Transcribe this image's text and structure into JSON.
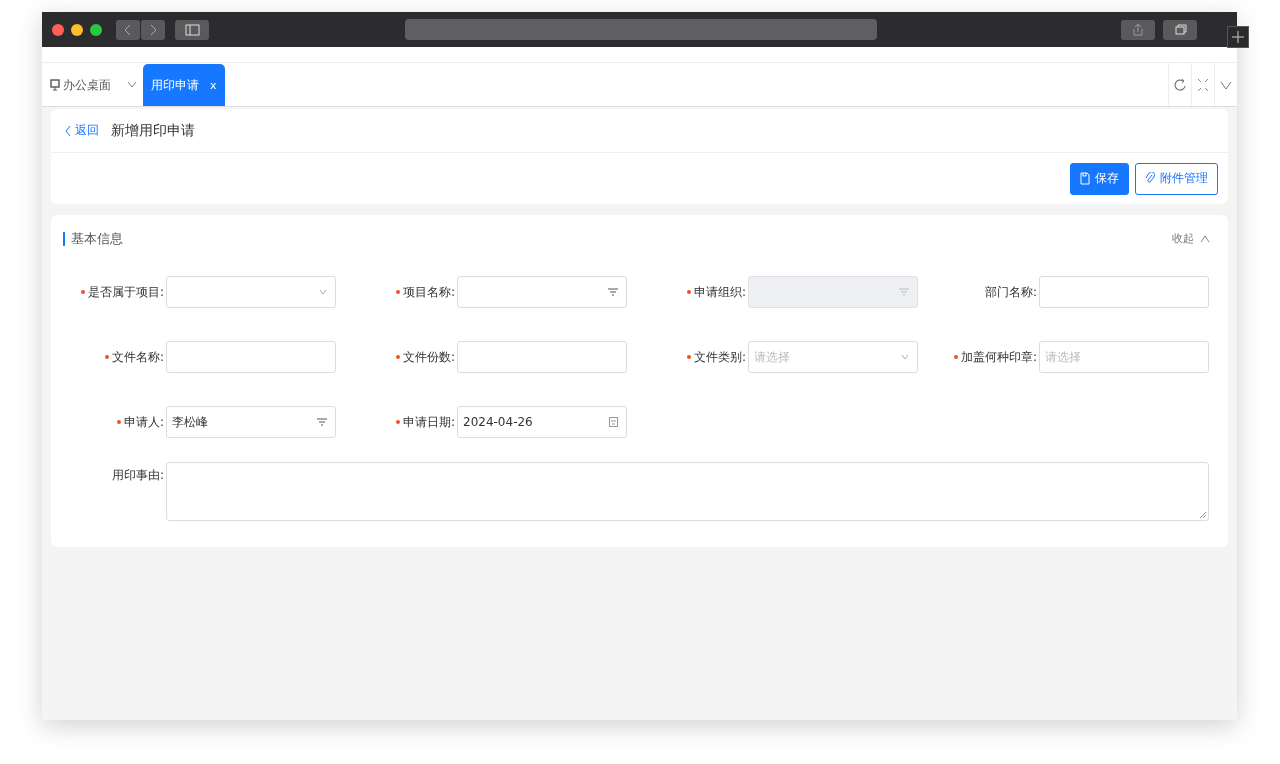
{
  "tabs": [
    {
      "label": "办公桌面",
      "kind": "home",
      "selected": false
    },
    {
      "label": "用印申请",
      "kind": "page",
      "selected": true,
      "close": "x"
    }
  ],
  "header": {
    "back": "返回",
    "title": "新增用印申请"
  },
  "buttons": [
    {
      "label": "保存",
      "kind": "primary"
    },
    {
      "label": "附件管理",
      "kind": "attach"
    }
  ],
  "section": {
    "title": "基本信息",
    "toggle": "收起",
    "expanded": true
  },
  "fields": [
    {
      "label": "是否属于项目:",
      "required": true,
      "kind": "select",
      "disabled": false
    },
    {
      "label": "项目名称:",
      "required": true,
      "kind": "lookup",
      "disabled": false
    },
    {
      "label": "申请组织:",
      "required": true,
      "kind": "lookup",
      "disabled": true
    },
    {
      "label": "部门名称:",
      "required": false,
      "kind": "text",
      "disabled": false
    },
    {
      "label": "文件名称:",
      "required": true,
      "kind": "text",
      "disabled": false
    },
    {
      "label": "文件份数:",
      "required": true,
      "kind": "text",
      "disabled": false
    },
    {
      "label": "文件类别:",
      "required": true,
      "kind": "select",
      "disabled": false,
      "placeholder": "请选择"
    },
    {
      "label": "加盖何种印章:",
      "required": true,
      "kind": "text",
      "disabled": false,
      "placeholder": "请选择"
    },
    {
      "label": "申请人:",
      "required": true,
      "kind": "lookup",
      "disabled": false,
      "value": "李松峰"
    },
    {
      "label": "申请日期:",
      "required": true,
      "kind": "date",
      "disabled": false,
      "value": "2024-04-26"
    },
    {
      "label": "用印事由:",
      "required": false,
      "kind": "textarea",
      "disabled": false
    }
  ]
}
